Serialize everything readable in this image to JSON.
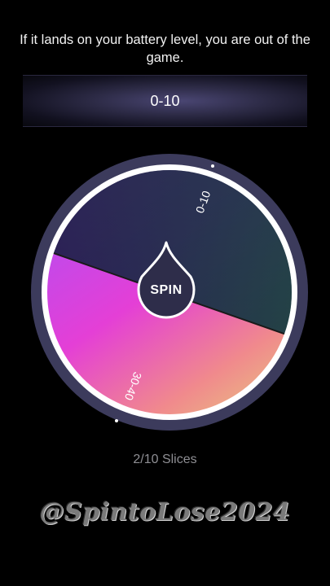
{
  "prompt": "If it lands on your battery level, you are out of the game.",
  "result": "0-10",
  "wheel": {
    "slices": [
      {
        "label": "0-10"
      },
      {
        "label": "30-40"
      }
    ],
    "spin_label": "SPIN"
  },
  "slice_count": "2/10 Slices",
  "watermark": "@SpintoLose2024"
}
